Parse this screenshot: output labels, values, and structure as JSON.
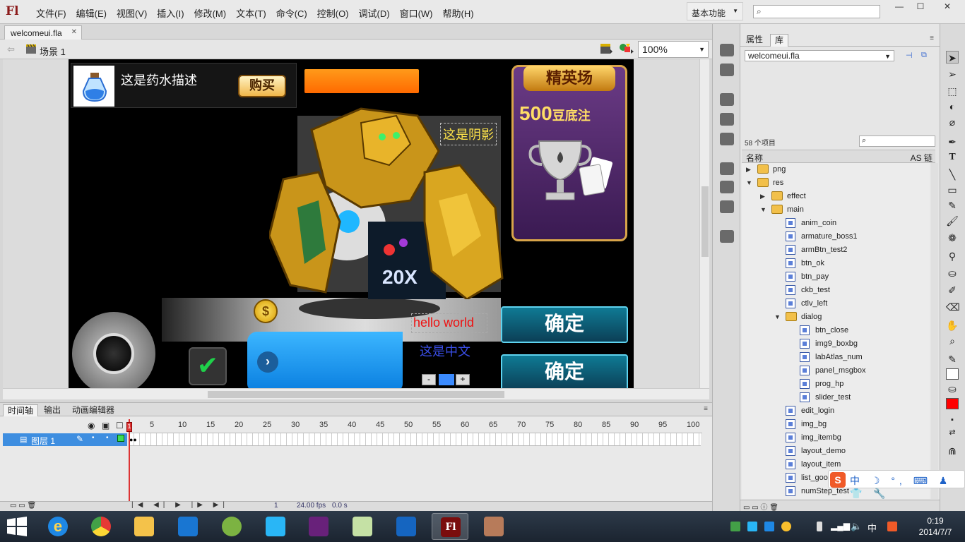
{
  "app": {
    "logo": "Fl",
    "menu": [
      "文件(F)",
      "编辑(E)",
      "视图(V)",
      "插入(I)",
      "修改(M)",
      "文本(T)",
      "命令(C)",
      "控制(O)",
      "调试(D)",
      "窗口(W)",
      "帮助(H)"
    ],
    "workspace": "基本功能",
    "window_controls": [
      "—",
      "☐",
      "✕"
    ]
  },
  "document": {
    "tab_label": "welcomeui.fla",
    "scene_label": "场景 1",
    "zoom": "100%"
  },
  "stage": {
    "item_description": "这是药水描述",
    "buy_label": "购买",
    "shadow_label": "这是阴影",
    "hello_label": "hello world",
    "chinese_label": "这是中文",
    "confirm_1": "确定",
    "confirm_2": "确定",
    "elite_title": "精英场",
    "elite_stake_number": "500",
    "elite_stake_text": "豆底注",
    "coin_symbol": "$",
    "step_minus": "-",
    "step_plus": "+",
    "badge_text": "20X"
  },
  "timeline": {
    "tabs": [
      "时间轴",
      "输出",
      "动画编辑器"
    ],
    "layer_name": "图层 1",
    "ruler_ticks": [
      "1",
      "5",
      "10",
      "15",
      "20",
      "25",
      "30",
      "35",
      "40",
      "45",
      "50",
      "55",
      "60",
      "65",
      "70",
      "75",
      "80",
      "85",
      "90",
      "95",
      "100"
    ],
    "current_frame": "1",
    "fps": "24.00 fps",
    "elapsed": "0.0 s"
  },
  "library": {
    "tabs": [
      "属性",
      "库"
    ],
    "document": "welcomeui.fla",
    "item_count": "58 个项目",
    "col_name": "名称",
    "col_as": "AS 链",
    "items": [
      {
        "label": "png",
        "type": "folder",
        "depth": 0,
        "open": false
      },
      {
        "label": "res",
        "type": "folder",
        "depth": 0,
        "open": true
      },
      {
        "label": "effect",
        "type": "folder",
        "depth": 1,
        "open": false
      },
      {
        "label": "main",
        "type": "folder",
        "depth": 1,
        "open": true
      },
      {
        "label": "anim_coin",
        "type": "symbol",
        "depth": 2
      },
      {
        "label": "armature_boss1",
        "type": "symbol",
        "depth": 2
      },
      {
        "label": "armBtn_test2",
        "type": "symbol",
        "depth": 2
      },
      {
        "label": "btn_ok",
        "type": "symbol",
        "depth": 2
      },
      {
        "label": "btn_pay",
        "type": "symbol",
        "depth": 2
      },
      {
        "label": "ckb_test",
        "type": "symbol",
        "depth": 2
      },
      {
        "label": "ctlv_left",
        "type": "symbol",
        "depth": 2
      },
      {
        "label": "dialog",
        "type": "folder",
        "depth": 2,
        "open": true
      },
      {
        "label": "btn_close",
        "type": "symbol",
        "depth": 3
      },
      {
        "label": "img9_boxbg",
        "type": "symbol",
        "depth": 3
      },
      {
        "label": "labAtlas_num",
        "type": "symbol",
        "depth": 3
      },
      {
        "label": "panel_msgbox",
        "type": "symbol",
        "depth": 3
      },
      {
        "label": "prog_hp",
        "type": "symbol",
        "depth": 3
      },
      {
        "label": "slider_test",
        "type": "symbol",
        "depth": 3
      },
      {
        "label": "edit_login",
        "type": "symbol",
        "depth": 2
      },
      {
        "label": "img_bg",
        "type": "symbol",
        "depth": 2
      },
      {
        "label": "img_itembg",
        "type": "symbol",
        "depth": 2
      },
      {
        "label": "layout_demo",
        "type": "symbol",
        "depth": 2
      },
      {
        "label": "layout_item",
        "type": "symbol",
        "depth": 2
      },
      {
        "label": "list_good",
        "type": "symbol",
        "depth": 2
      },
      {
        "label": "numStep_test",
        "type": "symbol",
        "depth": 2
      }
    ]
  },
  "ime": {
    "text": "中 ☽ °, ⌨ ♟ 👕 🔧"
  },
  "tray": {
    "time": "0:19",
    "date": "2014/7/7",
    "ime_lang": "中"
  }
}
